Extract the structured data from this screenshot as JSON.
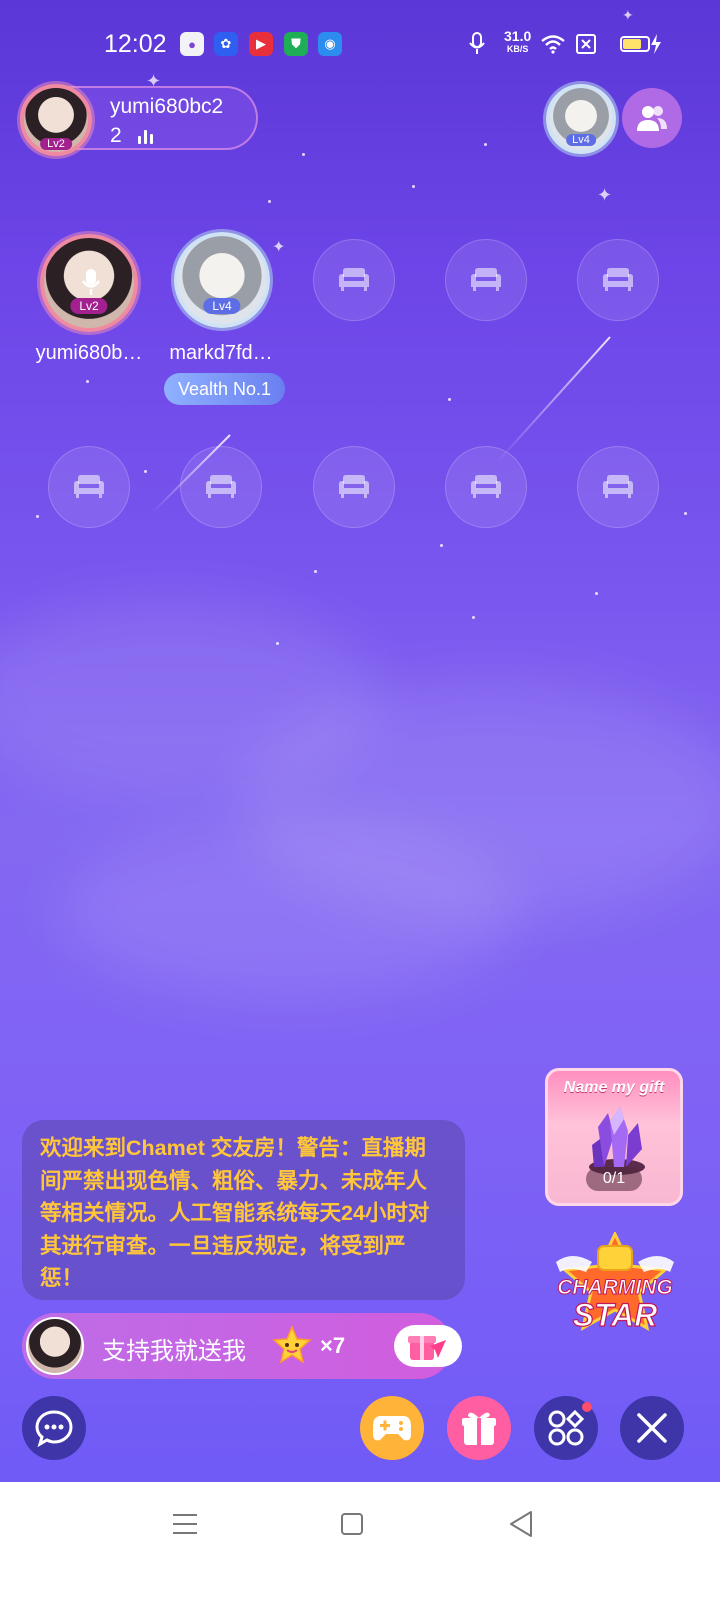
{
  "status_bar": {
    "time": "12:02",
    "net_speed": "31.0",
    "net_unit": "KB/S",
    "app_icons": [
      "chat-app-icon",
      "baidu-icon",
      "video-app-icon",
      "shield-app-icon",
      "browser-app-icon"
    ],
    "system_icons": [
      "mic-icon",
      "wifi-icon",
      "sim-icon",
      "battery-icon",
      "charging-icon"
    ],
    "battery_level": 0.75
  },
  "host": {
    "name": "yumi680bc2",
    "count": "2",
    "level": "Lv2"
  },
  "top_right": {
    "level": "Lv4"
  },
  "seats": {
    "occupied": [
      {
        "name": "yumi680b…",
        "level": "Lv2",
        "icon": "mic-icon"
      },
      {
        "name": "markd7fd…",
        "level": "Lv4",
        "tag": "Vealth No.1"
      }
    ],
    "empty_icon": "sofa-icon"
  },
  "notice": {
    "text": "欢迎来到Chamet 交友房！警告：直播期间严禁出现色情、粗俗、暴力、未成年人等相关情况。人工智能系统每天24小时对其进行审查。一旦违反规定，将受到严惩！"
  },
  "support": {
    "text": "支持我就送我",
    "multiplier": "×7"
  },
  "name_gift": {
    "title": "Name my gift",
    "count": "0/1"
  },
  "charming": {
    "line1": "CHARMING",
    "line2": "STAR"
  },
  "toolbar": [
    "chat-icon",
    "game-icon",
    "gift-icon",
    "apps-icon",
    "close-icon"
  ],
  "colors": {
    "notice_text": "#ffc63a",
    "support_pill": "#c665e4",
    "game_button": "#ffb338",
    "gift_button": "#ff5fa2",
    "dark_button": "#3e36a8"
  }
}
